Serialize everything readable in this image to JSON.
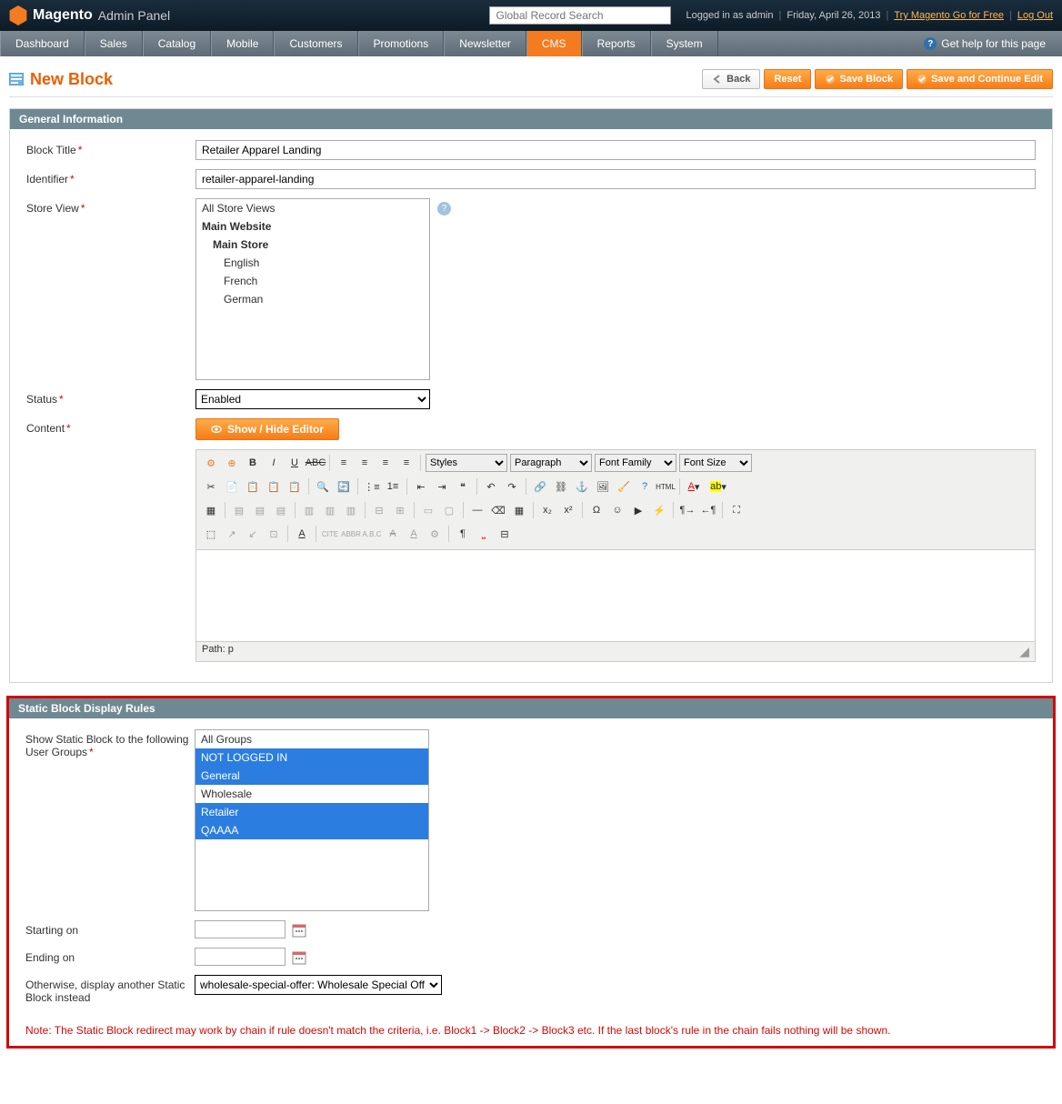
{
  "header": {
    "brand": "Magento",
    "brand_suffix": "Admin Panel",
    "search_placeholder": "Global Record Search",
    "logged_in": "Logged in as admin",
    "date": "Friday, April 26, 2013",
    "try_link": "Try Magento Go for Free",
    "logout": "Log Out"
  },
  "nav": {
    "items": [
      "Dashboard",
      "Sales",
      "Catalog",
      "Mobile",
      "Customers",
      "Promotions",
      "Newsletter",
      "CMS",
      "Reports",
      "System"
    ],
    "active": "CMS",
    "help": "Get help for this page"
  },
  "page": {
    "title": "New Block",
    "buttons": {
      "back": "Back",
      "reset": "Reset",
      "save": "Save Block",
      "save_continue": "Save and Continue Edit"
    }
  },
  "general": {
    "heading": "General Information",
    "labels": {
      "block_title": "Block Title",
      "identifier": "Identifier",
      "store_view": "Store View",
      "status": "Status",
      "content": "Content"
    },
    "values": {
      "block_title": "Retailer Apparel Landing",
      "identifier": "retailer-apparel-landing",
      "status": "Enabled"
    },
    "store_views": [
      {
        "text": "All Store Views",
        "indent": 0,
        "bold": false
      },
      {
        "text": "Main Website",
        "indent": 0,
        "bold": true
      },
      {
        "text": "Main Store",
        "indent": 1,
        "bold": true
      },
      {
        "text": "English",
        "indent": 2,
        "bold": false
      },
      {
        "text": "French",
        "indent": 2,
        "bold": false
      },
      {
        "text": "German",
        "indent": 2,
        "bold": false
      }
    ],
    "show_hide_editor": "Show / Hide Editor"
  },
  "editor": {
    "styles": "Styles",
    "paragraph": "Paragraph",
    "font_family": "Font Family",
    "font_size": "Font Size",
    "path_label": "Path:",
    "path_value": "p"
  },
  "rules": {
    "heading": "Static Block Display Rules",
    "labels": {
      "user_groups": "Show Static Block to the following User Groups",
      "starting": "Starting on",
      "ending": "Ending on",
      "otherwise": "Otherwise, display another Static Block instead"
    },
    "groups": [
      {
        "text": "All Groups",
        "selected": false
      },
      {
        "text": "NOT LOGGED IN",
        "selected": true
      },
      {
        "text": "General",
        "selected": true
      },
      {
        "text": "Wholesale",
        "selected": false
      },
      {
        "text": "Retailer",
        "selected": true
      },
      {
        "text": "QAAAA",
        "selected": true
      }
    ],
    "otherwise_value": "wholesale-special-offer: Wholesale Special Off",
    "note": "Note: The Static Block redirect may work by chain if rule doesn't match the criteria, i.e. Block1 -> Block2 -> Block3 etc. If the last block's rule in the chain fails nothing will be shown."
  }
}
